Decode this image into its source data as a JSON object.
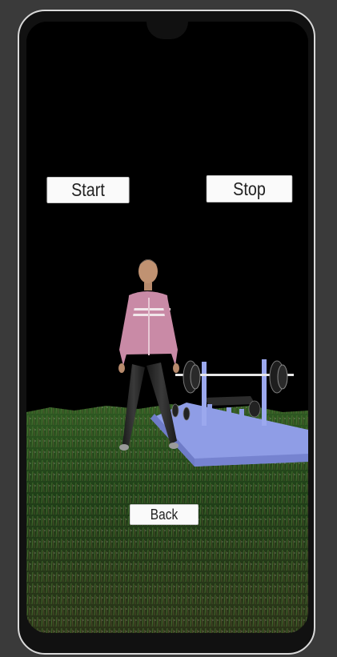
{
  "controls": {
    "start_label": "Start",
    "stop_label": "Stop",
    "back_label": "Back"
  },
  "scene": {
    "sky_color": "#000000",
    "grass_color": "#1e3d18",
    "jacket_color": "#c98aa6",
    "bench_color": "#8f9de6"
  }
}
